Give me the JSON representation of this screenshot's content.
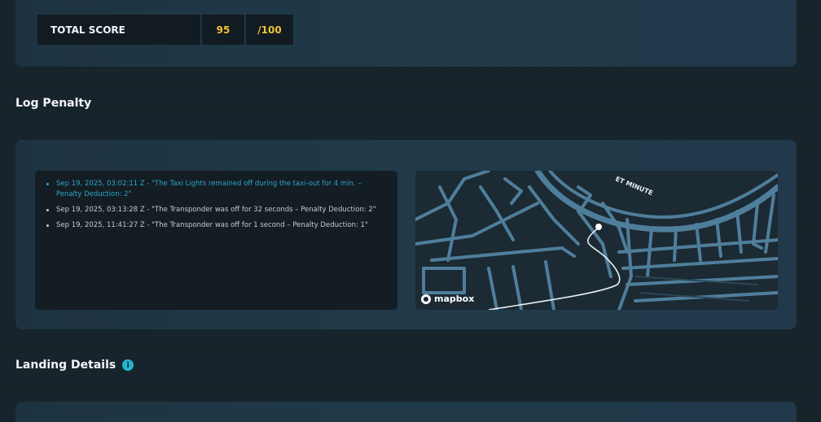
{
  "score": {
    "label": "TOTAL SCORE",
    "value": "95",
    "max": "/100"
  },
  "log_penalty": {
    "title": "Log Penalty",
    "entries": [
      {
        "text": "Sep 19, 2025, 03:02:11 Z - \"The Taxi Lights remained off during the taxi-out for 4 min. – Penalty Deduction: 2\"",
        "active": true
      },
      {
        "text": "Sep 19, 2025, 03:13:28 Z - \"The Transponder was off for 32 seconds – Penalty Deduction: 2\"",
        "active": false
      },
      {
        "text": "Sep 19, 2025, 11:41:27 Z - \"The Transponder was off for 1 second – Penalty Deduction: 1\"",
        "active": false
      }
    ]
  },
  "map": {
    "attribution": "mapbox",
    "street_label": "ET MINUTE",
    "icons": [
      "mapbox-logo-icon"
    ]
  },
  "landing": {
    "title": "Landing Details",
    "info_icon": "i"
  },
  "colors": {
    "accent": "#2aa6cc",
    "score": "#f2c230",
    "map_roads": "#4f7e9b"
  }
}
